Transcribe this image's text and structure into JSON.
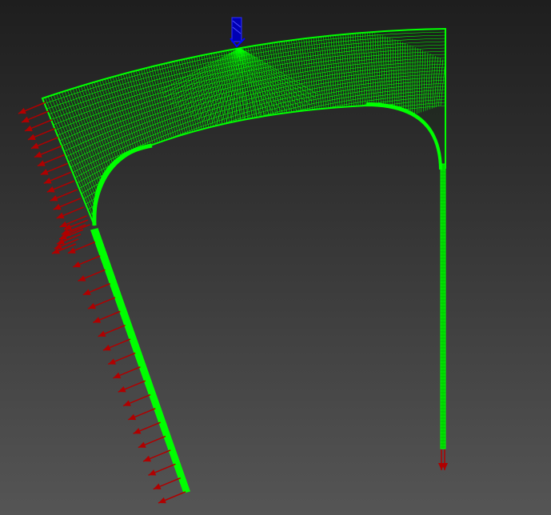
{
  "viewport": {
    "background_top": "#1e1e1e",
    "background_bottom": "#555555"
  },
  "model": {
    "type": "2D finite element mesh",
    "mesh_color": "#00ff00",
    "load_arrow_color": "#b00000",
    "constraint_color": "#0000b4",
    "left_leg_load_arrows": 34,
    "right_leg_load_arrows": 2,
    "constraint_markers": 1
  }
}
